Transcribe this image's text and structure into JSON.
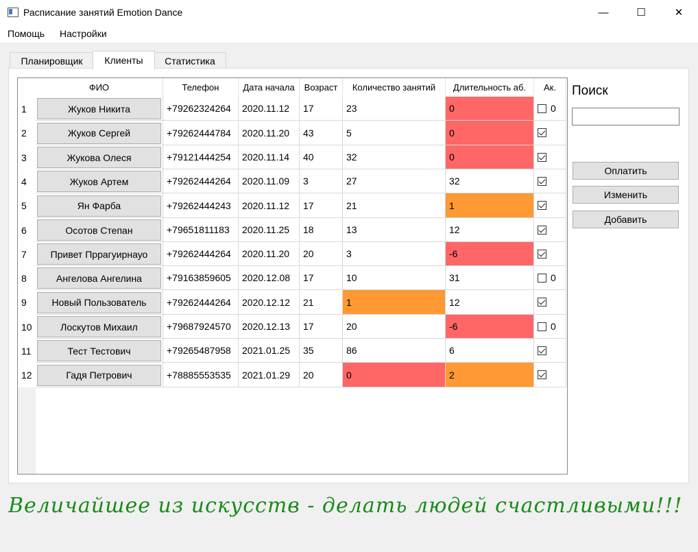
{
  "window": {
    "title": "Расписание занятий Emotion Dance",
    "minimize": "—",
    "maximize": "☐",
    "close": "✕"
  },
  "menu": [
    "Помощь",
    "Настройки"
  ],
  "tabs": [
    "Планировщик",
    "Клиенты",
    "Статистика"
  ],
  "active_tab": "Клиенты",
  "table": {
    "headers": [
      "ФИО",
      "Телефон",
      "Дата начала",
      "Возраст",
      "Количество занятий",
      "Длительность аб.",
      "Ак."
    ],
    "rows": [
      {
        "num": "1",
        "name": "Жуков Никита",
        "phone": "+79262324264",
        "date": "2020.11.12",
        "age": "17",
        "count": "23",
        "duration": "0",
        "active": false,
        "active_text": "0",
        "count_color": "",
        "duration_color": "red"
      },
      {
        "num": "2",
        "name": "Жуков Сергей",
        "phone": "+79262444784",
        "date": "2020.11.20",
        "age": "43",
        "count": "5",
        "duration": "0",
        "active": true,
        "active_text": "",
        "count_color": "",
        "duration_color": "red"
      },
      {
        "num": "3",
        "name": "Жукова Олеся",
        "phone": "+79121444254",
        "date": "2020.11.14",
        "age": "40",
        "count": "32",
        "duration": "0",
        "active": true,
        "active_text": "",
        "count_color": "",
        "duration_color": "red"
      },
      {
        "num": "4",
        "name": "Жуков Артем",
        "phone": "+79262444264",
        "date": "2020.11.09",
        "age": "3",
        "count": "27",
        "duration": "32",
        "active": true,
        "active_text": "",
        "count_color": "",
        "duration_color": ""
      },
      {
        "num": "5",
        "name": "Ян Фарба",
        "phone": "+79262444243",
        "date": "2020.11.12",
        "age": "17",
        "count": "21",
        "duration": "1",
        "active": true,
        "active_text": "",
        "count_color": "",
        "duration_color": "orange"
      },
      {
        "num": "6",
        "name": "Осотов Степан",
        "phone": "+79651811183",
        "date": "2020.11.25",
        "age": "18",
        "count": "13",
        "duration": "12",
        "active": true,
        "active_text": "",
        "count_color": "",
        "duration_color": ""
      },
      {
        "num": "7",
        "name": "Привет Пррагуирнауо",
        "phone": "+79262444264",
        "date": "2020.11.20",
        "age": "20",
        "count": "3",
        "duration": "-6",
        "active": true,
        "active_text": "",
        "count_color": "",
        "duration_color": "red"
      },
      {
        "num": "8",
        "name": "Ангелова Ангелина",
        "phone": "+79163859605",
        "date": "2020.12.08",
        "age": "17",
        "count": "10",
        "duration": "31",
        "active": false,
        "active_text": "0",
        "count_color": "",
        "duration_color": ""
      },
      {
        "num": "9",
        "name": "Новый Пользователь",
        "phone": "+79262444264",
        "date": "2020.12.12",
        "age": "21",
        "count": "1",
        "duration": "12",
        "active": true,
        "active_text": "",
        "count_color": "orange",
        "duration_color": ""
      },
      {
        "num": "10",
        "name": "Лоскутов Михаил",
        "phone": "+79687924570",
        "date": "2020.12.13",
        "age": "17",
        "count": "20",
        "duration": "-6",
        "active": false,
        "active_text": "0",
        "count_color": "",
        "duration_color": "red"
      },
      {
        "num": "11",
        "name": "Тест Тестович",
        "phone": "+79265487958",
        "date": "2021.01.25",
        "age": "35",
        "count": "86",
        "duration": "6",
        "active": true,
        "active_text": "",
        "count_color": "",
        "duration_color": ""
      },
      {
        "num": "12",
        "name": "Гадя Петрович",
        "phone": "+78885553535",
        "date": "2021.01.29",
        "age": "20",
        "count": "0",
        "duration": "2",
        "active": true,
        "active_text": "",
        "count_color": "red",
        "duration_color": "orange"
      }
    ]
  },
  "search": {
    "label": "Поиск",
    "value": ""
  },
  "actions": [
    "Оплатить",
    "Изменить",
    "Добавить"
  ],
  "motto": "Величайшее из искусств - делать людей счастливыми!!!",
  "colors": {
    "red": "#ff6666",
    "orange": "#ff9933",
    "motto": "#1a8a1a"
  }
}
